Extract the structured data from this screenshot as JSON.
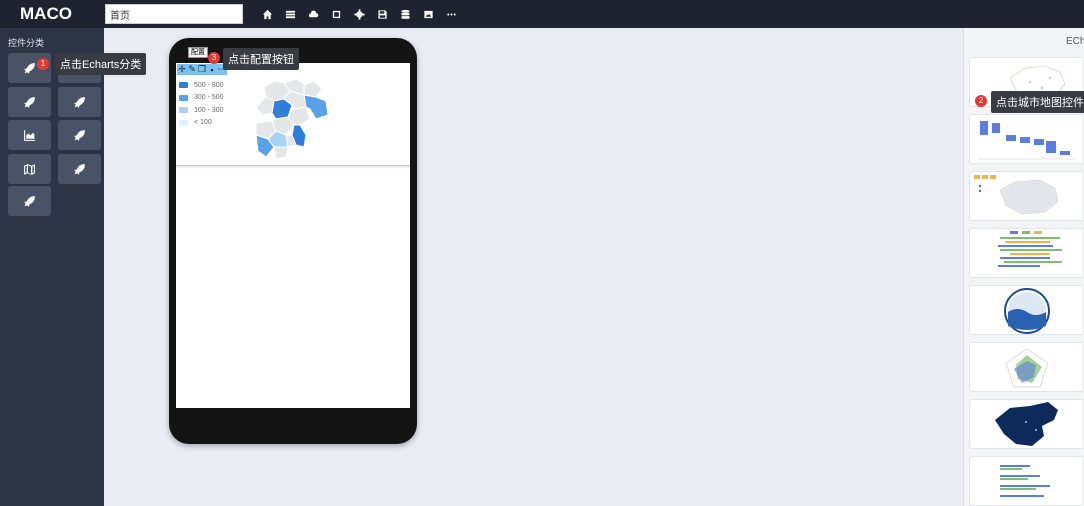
{
  "header": {
    "logo": "MACO",
    "page_name": "首页",
    "tools": [
      "home-icon",
      "list-icon",
      "cloud-icon",
      "square-icon",
      "gear-icon",
      "save-icon",
      "database-icon",
      "image-icon",
      "more-icon"
    ]
  },
  "sidebar": {
    "title": "控件分类",
    "categories": [
      "rocket-icon",
      "table-icon",
      "rocket-icon",
      "rocket-icon",
      "area-chart-icon",
      "rocket-icon",
      "map-icon",
      "rocket-icon",
      "rocket-icon"
    ]
  },
  "tips": {
    "step1": {
      "num": "1",
      "text": "点击Echarts分类"
    },
    "step2": {
      "num": "2",
      "text": "点击城市地图控件"
    },
    "step3": {
      "num": "3",
      "text": "点击配置按钮"
    }
  },
  "canvas": {
    "widget_tag": "配置",
    "widget_toolbar": [
      "move-icon",
      "wrench-icon",
      "copy-icon",
      "delete-icon",
      "more-icon"
    ],
    "legend": [
      {
        "label": "500 - 800",
        "color": "#2f7fd6"
      },
      {
        "label": "300 - 500",
        "color": "#5aa2e8"
      },
      {
        "label": "100 - 300",
        "color": "#a9d3f5"
      },
      {
        "label": "< 100",
        "color": "#e0f0fd"
      }
    ]
  },
  "right_panel": {
    "title": "ECha",
    "thumbs": [
      "china-map-chart",
      "bar-waterfall-chart",
      "china-scatter-map-chart",
      "horizontal-bar-chart",
      "liquid-fill-chart",
      "radar-chart",
      "china-dark-map-chart",
      "small-bar-chart"
    ]
  },
  "colors": {
    "topbar": "#1f2330",
    "sidebar": "#2d3446",
    "badge": "#e53935",
    "tooltip": "#383b42"
  }
}
